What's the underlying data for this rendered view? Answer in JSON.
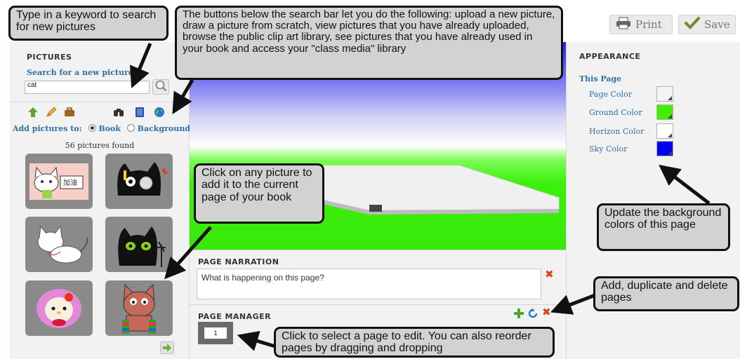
{
  "toolbar": {
    "print_label": "Print",
    "save_label": "Save"
  },
  "pictures_panel": {
    "title": "PICTURES",
    "search_label": "Search for a new picture",
    "search_value": "cat",
    "add_to_label": "Add pictures to:",
    "option_book": "Book",
    "option_background": "Background",
    "results_count": "56 pictures found",
    "tools": [
      "upload-arrow-icon",
      "pencil-icon",
      "briefcase-icon",
      "binoculars-icon",
      "book-icon",
      "globe-icon"
    ]
  },
  "appearance": {
    "title": "APPEARANCE",
    "this_page": "This Page",
    "colors": [
      {
        "label": "Page Color",
        "color": "#f4f4f4"
      },
      {
        "label": "Ground Color",
        "color": "#44ee00"
      },
      {
        "label": "Horizon Color",
        "color": "#ffffff"
      },
      {
        "label": "Sky Color",
        "color": "#0000ee"
      }
    ]
  },
  "narration": {
    "title": "PAGE NARRATION",
    "text": "What is happening on this page?"
  },
  "page_manager": {
    "title": "PAGE MANAGER",
    "page_number": "1"
  },
  "callouts": {
    "search": "Type in a keyword to search for new pictures",
    "buttons": "The buttons below the search bar let you do the following: upload a new picture, draw a picture from scratch, view pictures that you have already uploaded, browse the public clip art library, see pictures that you have already used in your book and access your \"class media\" library",
    "click_picture": "Click on any picture to add it to the current page of your book",
    "update_colors": "Update the background colors of this page",
    "add_pages": "Add, duplicate and delete pages",
    "select_page": "Click to select a page to edit.  You can also reorder pages by dragging and dropping"
  },
  "colors": {
    "accent_blue": "#2d6fa8",
    "delete_red": "#d9441c",
    "add_green": "#4aa832"
  }
}
